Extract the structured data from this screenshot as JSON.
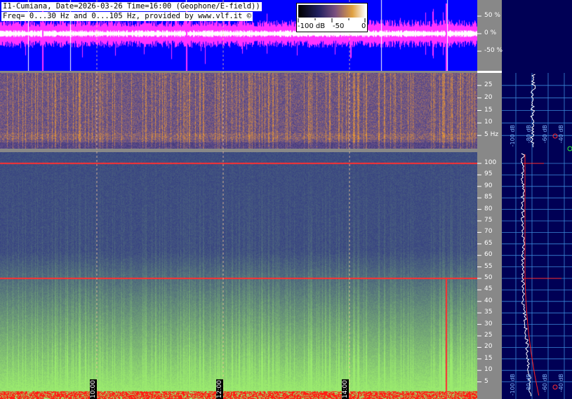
{
  "header": {
    "line1": "I1-Cumiana, Date=2026-03-26 Time=16:00 (Geophone/E-field))",
    "line2": "Freq= 0...30 Hz and 0...105 Hz, provided by www.vlf.it ©"
  },
  "colorbar": {
    "labels": [
      "-100 dB",
      "-50",
      "0"
    ],
    "ticks": [
      -100,
      -50,
      0
    ]
  },
  "colors": {
    "waveform_bg": "#0000ff",
    "waveform_trace": "#ff33ff",
    "waveform_center": "#ffffff",
    "panel_bg": "#000055",
    "grid": "#3a88d8",
    "spectrum_line": "#ffffff",
    "model_line": "#ff2020"
  },
  "chart_data": [
    {
      "type": "line",
      "name_on_chart": "",
      "description": "waveform amplitude",
      "y_ticks": [
        50,
        0,
        -50
      ],
      "y_tick_labels": [
        "50 %",
        "0 %",
        "-50 %"
      ],
      "ylim": [
        -100,
        100
      ]
    },
    {
      "type": "heatmap",
      "description": "spectrogram 0-30 Hz",
      "ylim": [
        0,
        30
      ],
      "y_ticks": [
        5,
        10,
        15,
        20,
        25
      ],
      "y_tick_labels": [
        "5 Hz",
        "10",
        "15",
        "20",
        "25"
      ]
    },
    {
      "type": "heatmap",
      "description": "spectrogram 0-105 Hz",
      "ylim": [
        0,
        105
      ],
      "y_ticks": [
        5,
        10,
        15,
        20,
        25,
        30,
        35,
        40,
        45,
        50,
        55,
        60,
        65,
        70,
        75,
        80,
        85,
        90,
        95,
        100
      ],
      "y_tick_labels": [
        "5",
        "10",
        "15",
        "20",
        "25",
        "30",
        "35",
        "40",
        "45",
        "50",
        "55",
        "60",
        "65",
        "70",
        "75",
        "80",
        "85",
        "90",
        "95",
        "100"
      ],
      "time_labels": [
        "10:00",
        "12:00",
        "14:00"
      ],
      "notable_lines_hz": [
        50,
        100
      ]
    },
    {
      "type": "line",
      "description": "spectrum profile",
      "x_tick_labels_top": [
        "-100 dB",
        "-80 dB",
        "-60 dB",
        "-40 dB",
        "-20 dB"
      ],
      "x_tick_labels_bottom": [
        "-100 dB",
        "-80 dB",
        "-60 dB",
        "-40 dB",
        "-20 dB"
      ]
    }
  ]
}
